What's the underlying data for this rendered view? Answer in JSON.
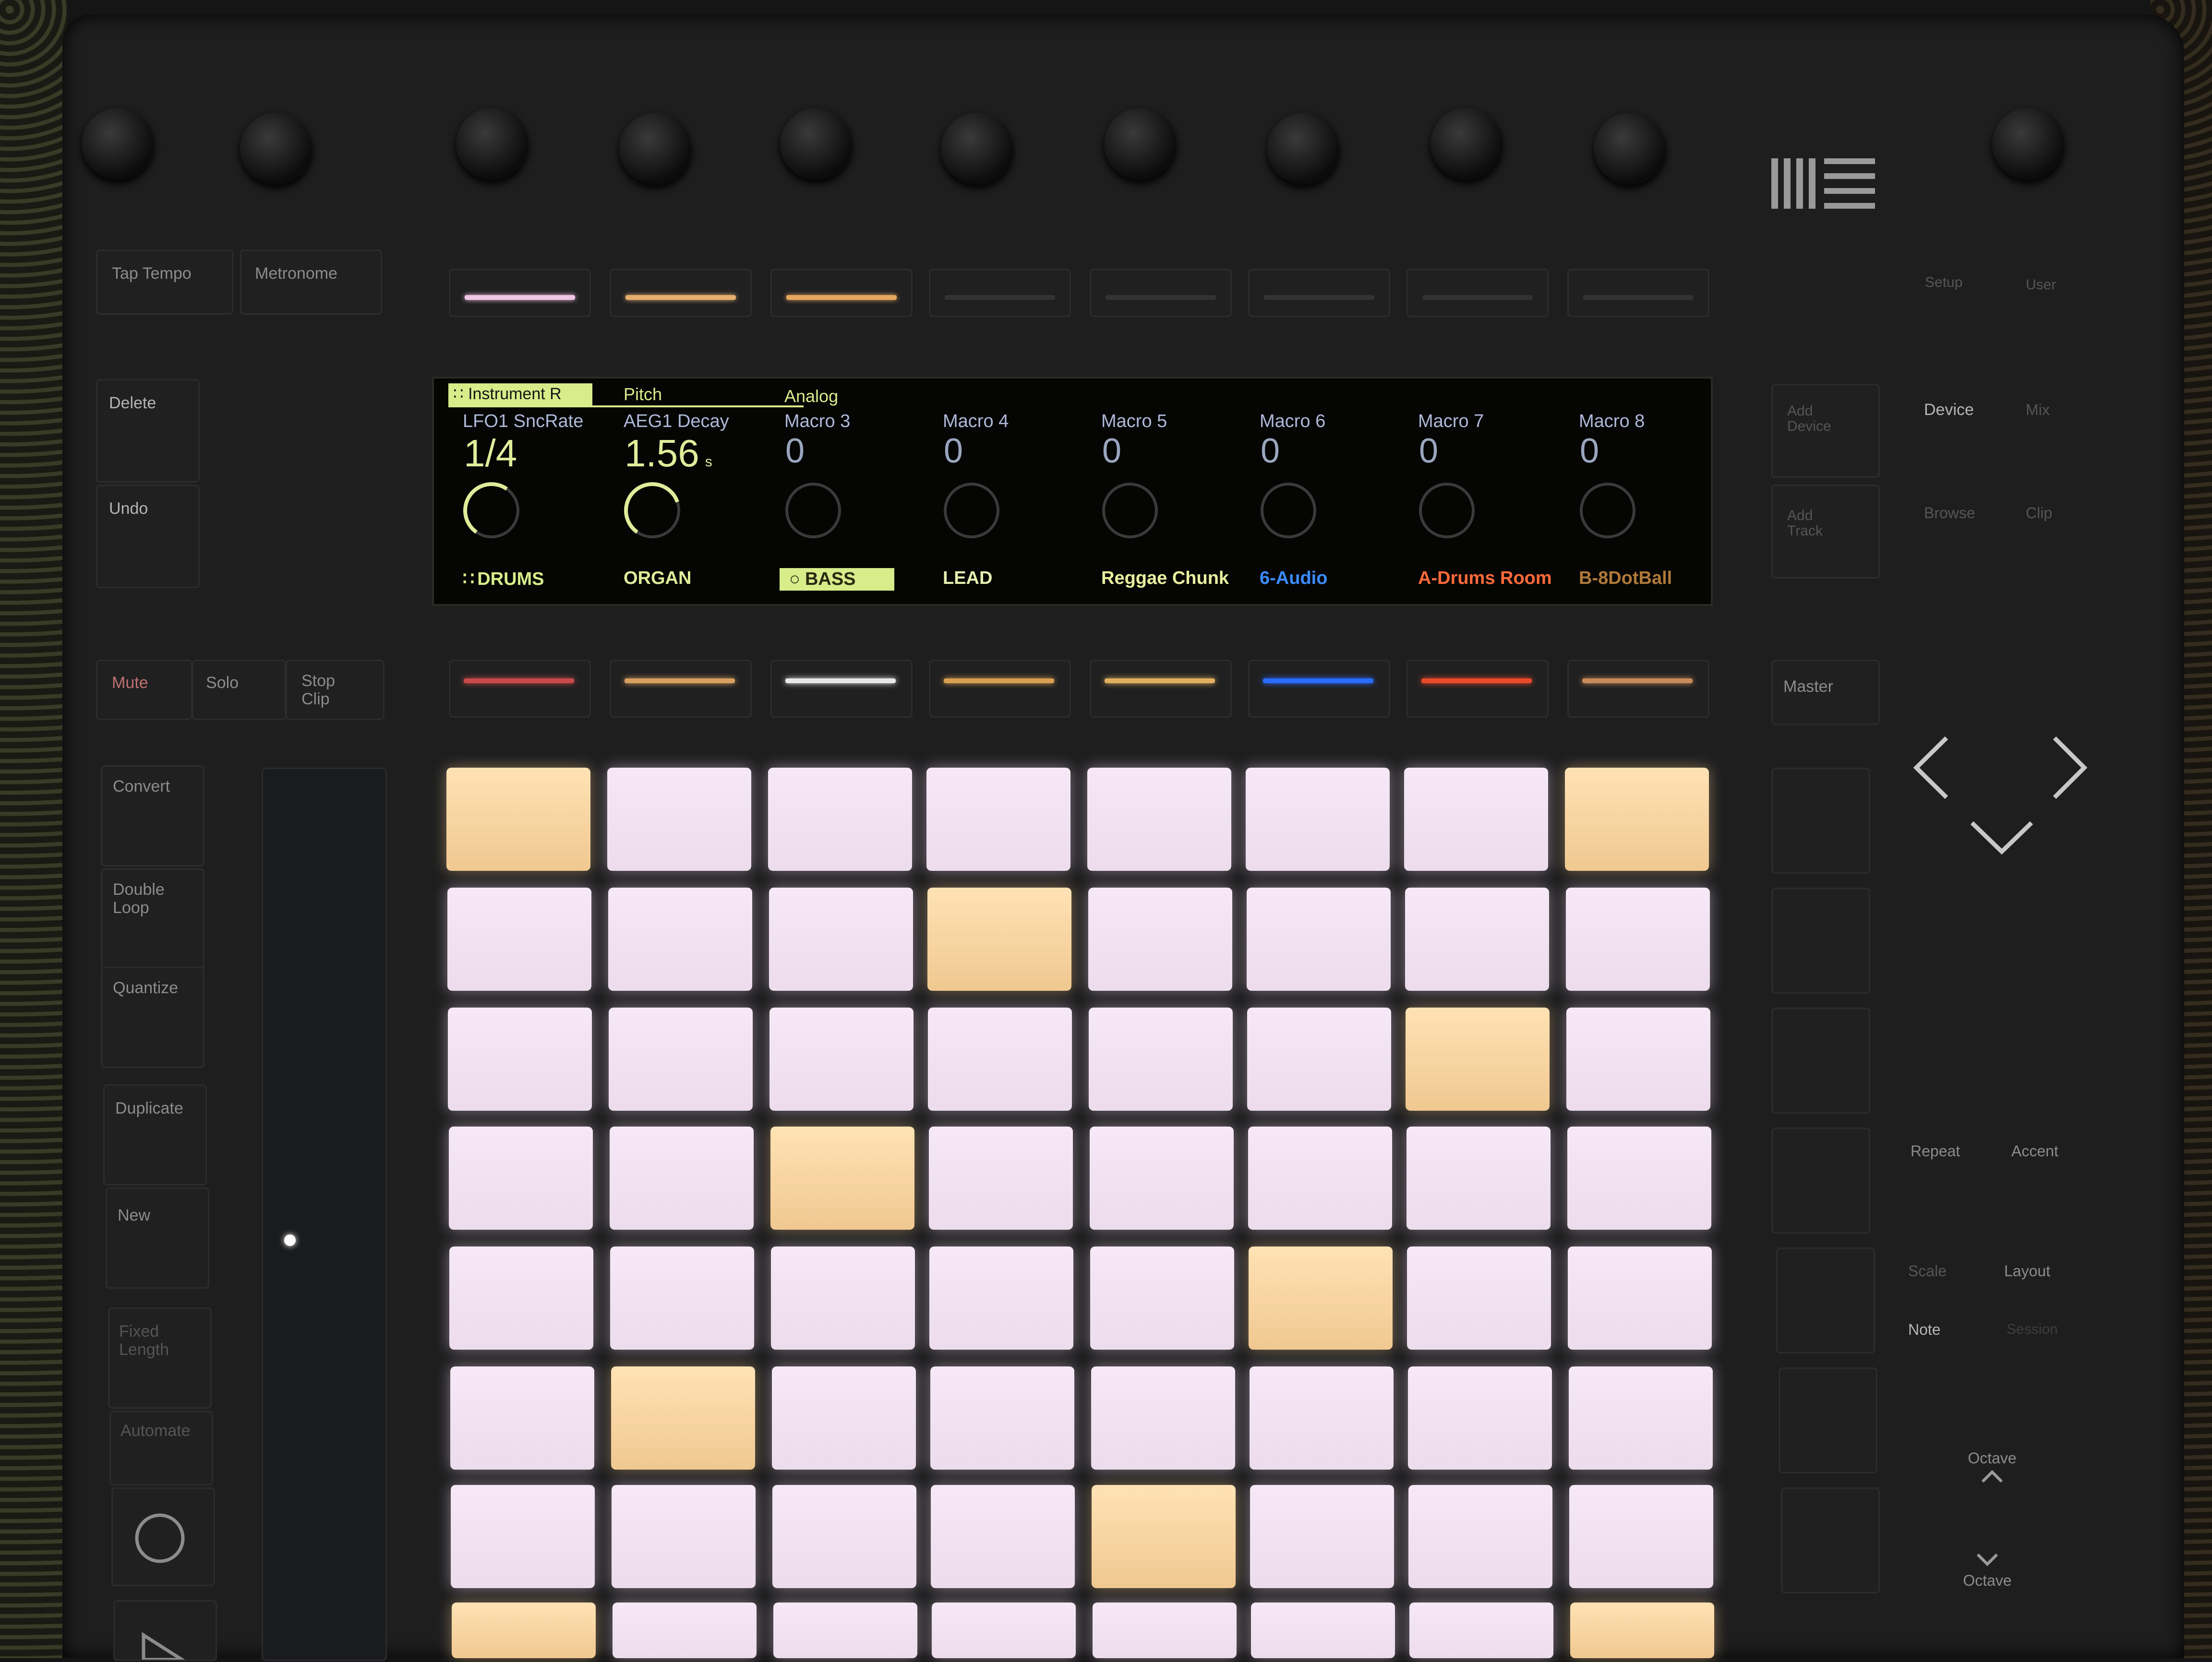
{
  "left_buttons": {
    "tap_tempo": "Tap Tempo",
    "metronome": "Metronome",
    "delete": "Delete",
    "undo": "Undo",
    "mute": "Mute",
    "solo": "Solo",
    "stop_clip": "Stop Clip",
    "convert": "Convert",
    "double_loop": "Double Loop",
    "quantize": "Quantize",
    "duplicate": "Duplicate",
    "new": "New",
    "fixed_length": "Fixed Length",
    "automate": "Automate"
  },
  "right_buttons": {
    "setup": "Setup",
    "user": "User",
    "add_device": "Add Device",
    "add_track": "Add Track",
    "device": "Device",
    "mix": "Mix",
    "browse": "Browse",
    "clip": "Clip",
    "master": "Master",
    "repeat": "Repeat",
    "accent": "Accent",
    "scale": "Scale",
    "layout": "Layout",
    "note": "Note",
    "session": "Session",
    "octave_up": "Octave",
    "octave_down": "Octave"
  },
  "top_strip_colors": [
    "#f2c6e6",
    "#e6b070",
    "#e6a860",
    "#333333",
    "#333333",
    "#333333",
    "#333333",
    "#333333"
  ],
  "display": {
    "breadcrumbs": [
      "Instrument R",
      "Pitch",
      "Analog"
    ],
    "params": [
      {
        "name": "LFO1 SncRate",
        "value": "1/4",
        "unit": "",
        "level": 0.5
      },
      {
        "name": "AEG1 Decay",
        "value": "1.56",
        "unit": "s",
        "level": 0.6
      },
      {
        "name": "Macro 3",
        "value": "0",
        "unit": "",
        "level": 0
      },
      {
        "name": "Macro 4",
        "value": "0",
        "unit": "",
        "level": 0
      },
      {
        "name": "Macro 5",
        "value": "0",
        "unit": "",
        "level": 0
      },
      {
        "name": "Macro 6",
        "value": "0",
        "unit": "",
        "level": 0
      },
      {
        "name": "Macro 7",
        "value": "0",
        "unit": "",
        "level": 0
      },
      {
        "name": "Macro 8",
        "value": "0",
        "unit": "",
        "level": 0
      }
    ],
    "tracks": [
      {
        "name": "DRUMS",
        "color": "#d8ec8a",
        "selected": false
      },
      {
        "name": "ORGAN",
        "color": "#e0ec9a",
        "selected": false
      },
      {
        "name": "BASS",
        "color": "#d8ec8a",
        "selected": true
      },
      {
        "name": "LEAD",
        "color": "#e6efb0",
        "selected": false
      },
      {
        "name": "Reggae Chunk",
        "color": "#e8f0a0",
        "selected": false
      },
      {
        "name": "6-Audio",
        "color": "#3a8cff",
        "selected": false
      },
      {
        "name": "A-Drums Room",
        "color": "#ff6a3a",
        "selected": false
      },
      {
        "name": "B-8DotBall",
        "color": "#b07a3a",
        "selected": false
      }
    ]
  },
  "track_strip_colors": [
    "#c84a4a",
    "#d8a060",
    "#e8e8e8",
    "#d8a050",
    "#e0b060",
    "#2a6cff",
    "#e84a2a",
    "#c88a5a"
  ],
  "pad_grid": [
    [
      "orange",
      "pink",
      "pink",
      "pink",
      "pink",
      "pink",
      "pink",
      "orange"
    ],
    [
      "pink",
      "pink",
      "pink",
      "orange",
      "pink",
      "pink",
      "pink",
      "pink"
    ],
    [
      "pink",
      "pink",
      "pink",
      "pink",
      "pink",
      "pink",
      "orange",
      "pink"
    ],
    [
      "pink",
      "pink",
      "orange",
      "pink",
      "pink",
      "pink",
      "pink",
      "pink"
    ],
    [
      "pink",
      "pink",
      "pink",
      "pink",
      "pink",
      "orange",
      "pink",
      "pink"
    ],
    [
      "pink",
      "orange",
      "pink",
      "pink",
      "pink",
      "pink",
      "pink",
      "pink"
    ],
    [
      "pink",
      "pink",
      "pink",
      "pink",
      "orange",
      "pink",
      "pink",
      "pink"
    ],
    [
      "orange",
      "pink",
      "pink",
      "pink",
      "pink",
      "pink",
      "pink",
      "orange"
    ]
  ],
  "icons": [
    "ableton-logo-icon",
    "arrow-left-icon",
    "arrow-right-icon",
    "arrow-down-icon",
    "record-icon",
    "play-icon",
    "octave-up-icon",
    "octave-down-icon"
  ]
}
